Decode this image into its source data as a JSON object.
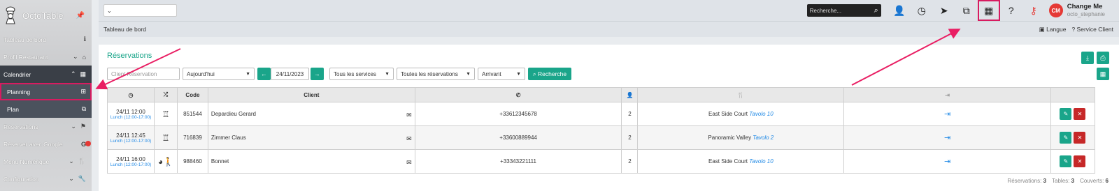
{
  "sidebar": {
    "brand": "OctoTable",
    "items": [
      {
        "label": "Tableau de bord",
        "icon": "info-icon",
        "glyph": "ℹ"
      },
      {
        "label": "Profil Restaurant",
        "icon": "home-icon",
        "glyph": "⌂"
      },
      {
        "label": "Calendrier",
        "icon": "calendar-icon",
        "glyph": "▦"
      },
      {
        "label": "Planning",
        "icon": "table-icon",
        "glyph": "⊞"
      },
      {
        "label": "Plan",
        "icon": "sitemap-icon",
        "glyph": "⧉"
      },
      {
        "label": "Réservations",
        "icon": "flag-icon",
        "glyph": "⚑"
      },
      {
        "label": "Réserver avec Google",
        "icon": "google-icon",
        "glyph": "G"
      },
      {
        "label": "Menu Numérique",
        "icon": "cutlery-icon",
        "glyph": "🍴"
      },
      {
        "label": "Configuration",
        "icon": "wrench-icon",
        "glyph": "🔧"
      }
    ]
  },
  "topbar": {
    "select_value": "",
    "search_placeholder": "Recherche...",
    "user_initials": "CM",
    "user_name": "Change Me",
    "user_login": "octo_stephanie"
  },
  "crumbs": {
    "title": "Tableau de bord",
    "langue": "Langue",
    "service": "? Service Client"
  },
  "panel": {
    "title": "Réservations",
    "filters": {
      "client_placeholder": "Client Réservation",
      "period": "Aujourd'hui",
      "date": "24/11/2023",
      "services": "Tous les services",
      "reservations": "Toutes les réservations",
      "status": "Arrivant",
      "search_label": "Recherche"
    },
    "columns": {
      "code": "Code",
      "client": "Client"
    },
    "rows": [
      {
        "time": "24/11 12:00",
        "service": "Lunch (12:00-17:00)",
        "code": "851544",
        "client": "Depardieu Gerard",
        "phone": "+33612345678",
        "covers": "2",
        "room": "East Side Court",
        "table": "Tavolo 10"
      },
      {
        "time": "24/11 12:45",
        "service": "Lunch (12:00-17:00)",
        "code": "716839",
        "client": "Zimmer Claus",
        "phone": "+33600889944",
        "covers": "2",
        "room": "Panoramic Valley",
        "table": "Tavolo 2"
      },
      {
        "time": "24/11 16:00",
        "service": "Lunch (12:00-17:00)",
        "code": "988460",
        "client": "Bonnet",
        "phone": "+33343221111",
        "covers": "2",
        "room": "East Side Court",
        "table": "Tavolo 10"
      }
    ],
    "totals": {
      "reservations_label": "Réservations:",
      "reservations": "3",
      "tables_label": "Tables:",
      "tables": "3",
      "couverts_label": "Couverts:",
      "couverts": "6"
    }
  },
  "colors": {
    "accent": "#1aa58a",
    "highlight": "#d81b60",
    "danger": "#c62828"
  }
}
